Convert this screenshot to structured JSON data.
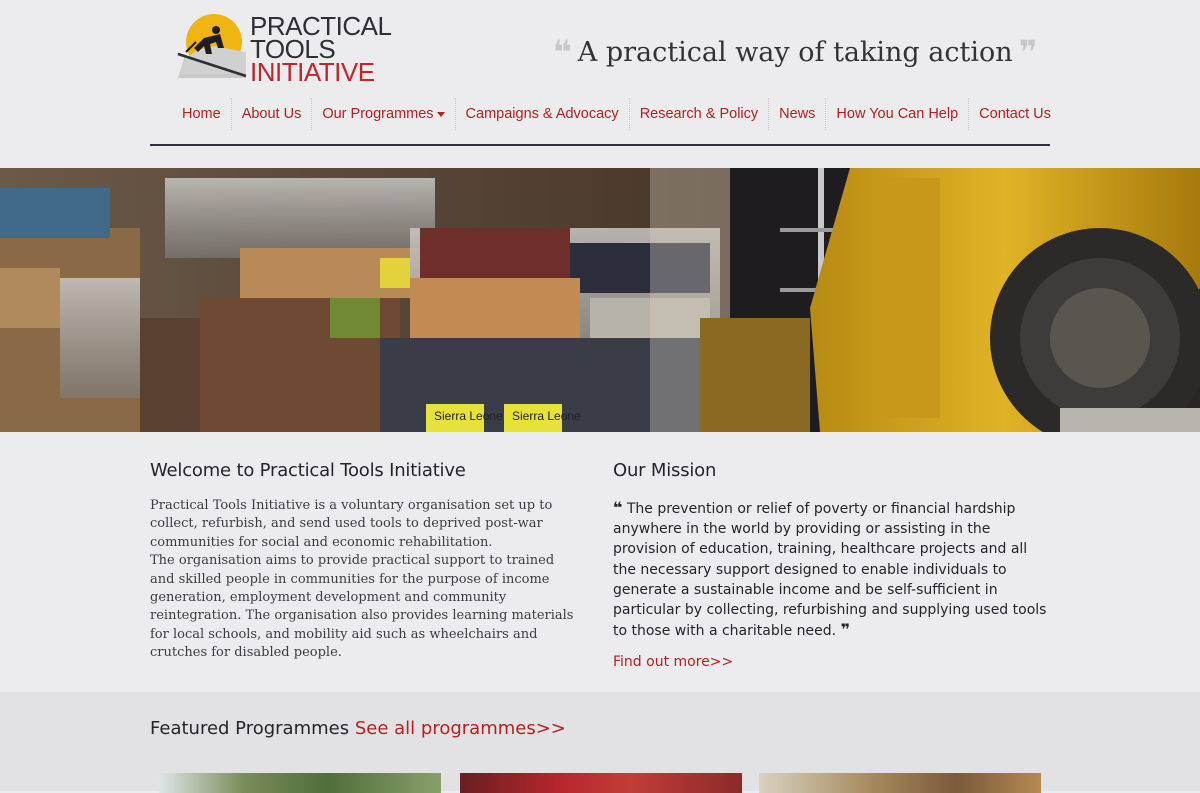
{
  "header": {
    "logo": {
      "line1": "PRACTICAL",
      "line2": "TOOLS",
      "line3": "INITIATIVE"
    },
    "tagline": "A practical way of taking action"
  },
  "nav": {
    "items": [
      {
        "label": "Home"
      },
      {
        "label": "About Us"
      },
      {
        "label": "Our Programmes"
      },
      {
        "label": "Campaigns & Advocacy"
      },
      {
        "label": "Research & Policy"
      },
      {
        "label": "News"
      },
      {
        "label": "How You Can Help"
      },
      {
        "label": "Contact Us"
      }
    ]
  },
  "hero": {
    "box_labels": [
      "Sierra Leone",
      "Sierra Leone"
    ]
  },
  "welcome": {
    "title": "Welcome to Practical Tools Initiative",
    "para1": "Practical Tools Initiative is a voluntary organisation set up to collect, refurbish, and send used tools to deprived post-war communities for social and economic rehabilitation.",
    "para2": "The organisation aims to provide practical support to trained and skilled people in communities for the purpose of income generation, employment development and community reintegration. The organisation also provides learning materials for local schools, and mobility aid such as wheelchairs and crutches for disabled people."
  },
  "mission": {
    "title": "Our Mission",
    "quote": "The prevention or relief of poverty or financial hardship anywhere in the world by providing or assisting in the provision of education, training, healthcare projects and all the necessary support designed to enable individuals to generate a sustainable income and be self-sufficient in particular by collecting, refurbishing and supplying used tools to those with a charitable need.",
    "link": "Find out more>>"
  },
  "featured": {
    "title": "Featured Programmes",
    "link": "See all programmes>>"
  },
  "colors": {
    "accent": "#b3211f",
    "background": "#ececef",
    "dark_text": "#24242c"
  }
}
